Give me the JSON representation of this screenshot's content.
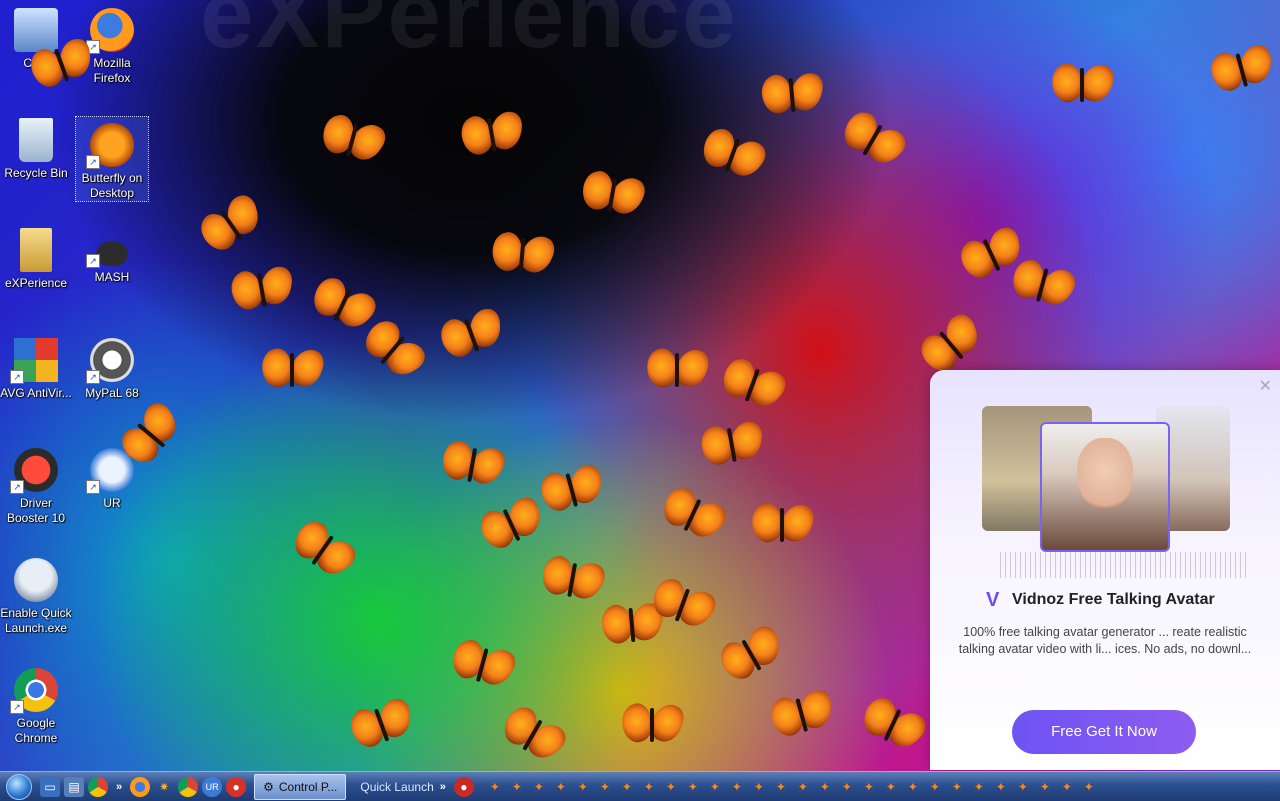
{
  "desktop": {
    "watermark": "eXPerience",
    "icons": [
      {
        "label": "Co..."
      },
      {
        "label": "Mozilla Firefox"
      },
      {
        "label": "Recycle Bin"
      },
      {
        "label": "Butterfly on Desktop"
      },
      {
        "label": "eXPerience"
      },
      {
        "label": "MASH"
      },
      {
        "label": "AVG AntiVir..."
      },
      {
        "label": "MyPaL 68"
      },
      {
        "label": "Driver Booster 10"
      },
      {
        "label": "UR"
      },
      {
        "label": "Enable Quick Launch.exe"
      },
      {
        "label": "Google Chrome"
      }
    ]
  },
  "popup": {
    "brand": "Vidnoz Free Talking Avatar",
    "description": "100% free talking avatar generator ... reate realistic talking avatar video with li... ices. No ads, no downl...",
    "cta": "Free Get It Now",
    "close_icon": "close-icon"
  },
  "taskbar": {
    "active_window": "Control P...",
    "quick_launch_label": "Quick Launch",
    "chevron": "»",
    "start_icon": "windows-start-orb"
  },
  "colors": {
    "accent": "#6d53f4",
    "butterfly": "#f4801a",
    "taskbar": "#2b4f8f"
  }
}
